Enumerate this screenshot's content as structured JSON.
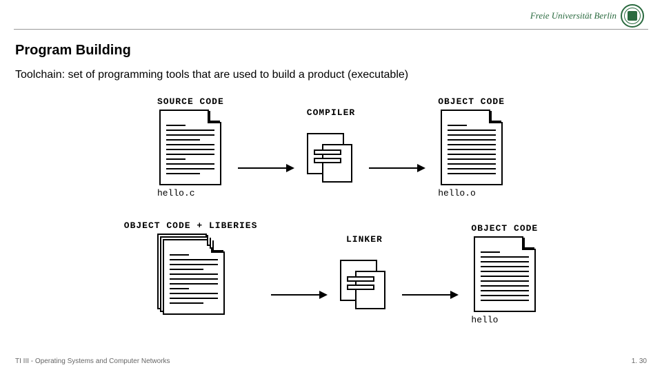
{
  "header": {
    "logo_text": "Freie Universität Berlin"
  },
  "title": "Program Building",
  "subtitle": "Toolchain: set of programming tools that are used to build a product (executable)",
  "diagram": {
    "row1": {
      "left": {
        "top_label": "SOURCE CODE",
        "bottom_label": "hello.c"
      },
      "middle": {
        "top_label": "COMPILER"
      },
      "right": {
        "top_label": "OBJECT CODE",
        "bottom_label": "hello.o"
      }
    },
    "row2": {
      "left": {
        "top_label": "OBJECT CODE + LIBERIES"
      },
      "middle": {
        "top_label": "LINKER"
      },
      "right": {
        "top_label": "OBJECT CODE",
        "bottom_label": "hello"
      }
    }
  },
  "footer": {
    "left": "TI III - Operating Systems and Computer Networks",
    "right": "1. 30"
  }
}
